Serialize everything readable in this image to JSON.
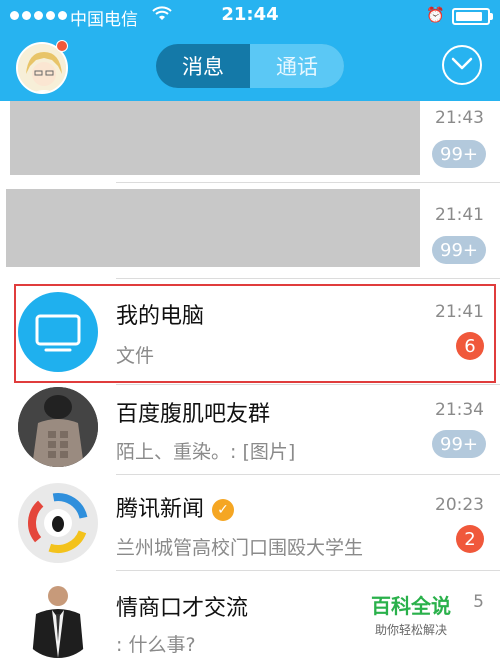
{
  "status_bar": {
    "carrier": "中国电信",
    "time": "21:44",
    "wifi_icon": "wifi-icon",
    "alarm_icon": "alarm-icon",
    "battery_level": 0.85
  },
  "header": {
    "tabs": [
      {
        "label": "消息",
        "active": true
      },
      {
        "label": "通话",
        "active": false
      }
    ],
    "accent": "#27b3f0"
  },
  "chats": [
    {
      "time": "21:43",
      "unread": "99+",
      "masked": true
    },
    {
      "time": "21:41",
      "unread": "99+",
      "masked": true
    },
    {
      "name": "我的电脑",
      "preview": "文件",
      "time": "21:41",
      "unread": "6",
      "avatar": "monitor-icon"
    },
    {
      "name": "百度腹肌吧友群",
      "preview": "陌上、重染。: [图片]",
      "time": "21:34",
      "unread": "99+"
    },
    {
      "name": "腾讯新闻",
      "preview": "兰州城管高校门口围殴大学生",
      "time": "20:23",
      "unread": "2",
      "verified": true
    },
    {
      "name": "情商口才交流",
      "preview": ": 什么事?",
      "time": "5"
    }
  ],
  "watermark": {
    "title": "百科全说",
    "subtitle": "助你轻松解决"
  }
}
